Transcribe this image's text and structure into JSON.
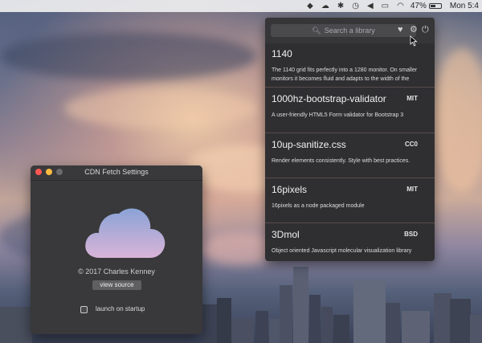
{
  "menubar": {
    "battery_percent": "47%",
    "clock": "Mon 5:4",
    "icons": [
      "adobe-icon",
      "cloud-icon",
      "bluetooth-icon",
      "time-machine-icon",
      "volume-icon",
      "airplay-icon",
      "wifi-icon",
      "battery-icon"
    ]
  },
  "popover": {
    "search_placeholder": "Search a library",
    "header_icons": [
      "heart-icon",
      "settings-icon",
      "power-icon"
    ],
    "libraries": [
      {
        "name": "1140",
        "license": "",
        "description": "The 1140 grid fits perfectly into a 1280 monitor. On smaller monitors it becomes fluid and adapts to the width of the"
      },
      {
        "name": "1000hz-bootstrap-validator",
        "license": "MIT",
        "description": "A user-friendly HTML5 Form validator for Bootstrap 3"
      },
      {
        "name": "10up-sanitize.css",
        "license": "CC0",
        "description": "Render elements consistently. Style with best practices."
      },
      {
        "name": "16pixels",
        "license": "MIT",
        "description": "16pixels as a node packaged module"
      },
      {
        "name": "3Dmol",
        "license": "BSD",
        "description": "Object oriented Javascript molecular visualization library"
      }
    ]
  },
  "settings": {
    "title": "CDN Fetch Settings",
    "copyright": "© 2017 Charles Kenney",
    "view_source_label": "view source",
    "launch_label": "launch on startup",
    "launch_checked": false
  },
  "colors": {
    "close": "#fc5753",
    "minimize": "#fdbc40",
    "zoom": "#6a6a6c",
    "cloud_top": "#8aa3d6",
    "cloud_bottom": "#d9b4d8"
  }
}
